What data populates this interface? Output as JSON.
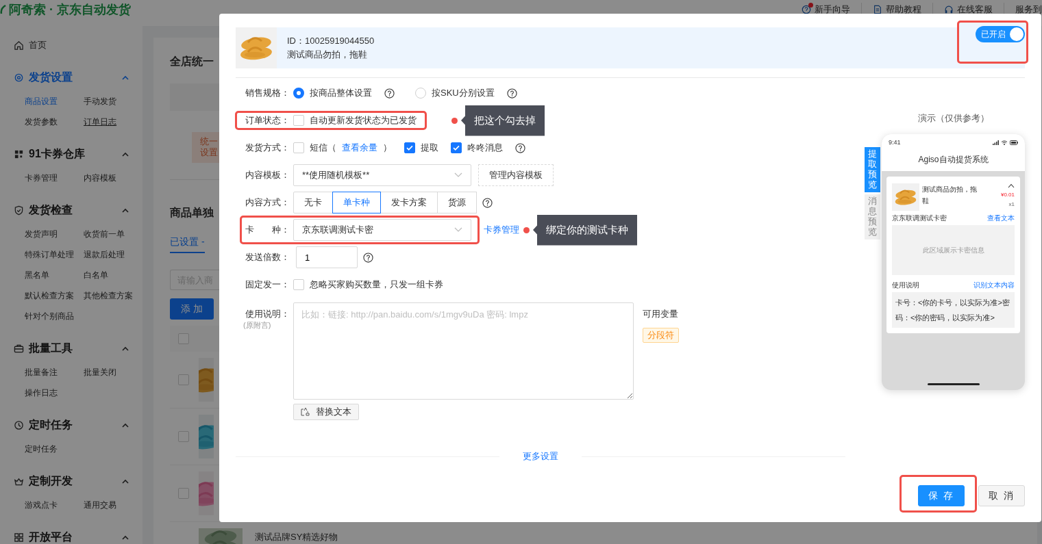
{
  "header": {
    "logo": "阿奇索 · 京东自动发货",
    "links": [
      {
        "label": "新手向导",
        "notification": true
      },
      {
        "label": "帮助教程",
        "notification": false
      },
      {
        "label": "在线客服",
        "notification": false
      },
      {
        "label": "服务到",
        "notification": false
      }
    ]
  },
  "sidebar": {
    "home": "首页",
    "groups": [
      {
        "title": "发货设置",
        "selected": true,
        "expanded": true,
        "items": [
          {
            "label": "商品设置",
            "selected": true,
            "hovered": false
          },
          {
            "label": "手动发货",
            "selected": false,
            "hovered": false
          },
          {
            "label": "发货参数",
            "selected": false,
            "hovered": false
          },
          {
            "label": "订单日志",
            "selected": false,
            "hovered": true
          }
        ]
      },
      {
        "title": "91卡券仓库",
        "selected": false,
        "expanded": true,
        "items": [
          {
            "label": "卡券管理",
            "selected": false,
            "hovered": false
          },
          {
            "label": "内容模板",
            "selected": false,
            "hovered": false
          }
        ]
      },
      {
        "title": "发货检查",
        "selected": false,
        "expanded": true,
        "items": [
          {
            "label": "发货声明",
            "selected": false,
            "hovered": false
          },
          {
            "label": "收货前一单",
            "selected": false,
            "hovered": false
          },
          {
            "label": "特殊订单处理",
            "selected": false,
            "hovered": false
          },
          {
            "label": "退款后处理",
            "selected": false,
            "hovered": false
          },
          {
            "label": "黑名单",
            "selected": false,
            "hovered": false
          },
          {
            "label": "白名单",
            "selected": false,
            "hovered": false
          },
          {
            "label": "默认检查方案",
            "selected": false,
            "hovered": false
          },
          {
            "label": "其他检查方案",
            "selected": false,
            "hovered": false
          },
          {
            "label": "针对个别商品",
            "selected": false,
            "hovered": false
          }
        ]
      },
      {
        "title": "批量工具",
        "selected": false,
        "expanded": true,
        "items": [
          {
            "label": "批量备注",
            "selected": false,
            "hovered": false
          },
          {
            "label": "批量关闭",
            "selected": false,
            "hovered": false
          },
          {
            "label": "操作日志",
            "selected": false,
            "hovered": false
          }
        ]
      },
      {
        "title": "定时任务",
        "selected": false,
        "expanded": true,
        "items": [
          {
            "label": "定时任务",
            "selected": false,
            "hovered": false
          }
        ]
      },
      {
        "title": "定制开发",
        "selected": false,
        "expanded": true,
        "items": [
          {
            "label": "游戏点卡",
            "selected": false,
            "hovered": false
          },
          {
            "label": "通用交易",
            "selected": false,
            "hovered": false
          }
        ]
      },
      {
        "title": "开放平台",
        "selected": false,
        "expanded": true
      }
    ]
  },
  "content": {
    "title": "全店统一",
    "notice": "统一设置",
    "section_title": "商品单独",
    "tab": {
      "label": "已设置 -",
      "selected": true
    },
    "search_placeholder": "请输入商",
    "add_button": "添 加",
    "header_checked": false,
    "rows": [
      {
        "kind": "picture",
        "checked": false
      },
      {
        "kind": "picture",
        "checked": false
      },
      {
        "kind": "picture",
        "checked": false
      },
      {
        "kind": "picture",
        "name": "测试品牌SY精选好物"
      }
    ]
  },
  "modal": {
    "product": {
      "id_text": "ID：10025919044550",
      "name": "测试商品勿拍，拖鞋"
    },
    "toggle": {
      "label": "已开启",
      "on": true,
      "highlighted": true
    },
    "form": [
      {
        "kind": "radio",
        "label": "销售规格：",
        "options": [
          {
            "label": "按商品整体设置",
            "selected": true
          },
          {
            "label": "按SKU分别设置",
            "selected": false
          }
        ]
      },
      {
        "kind": "checkbox",
        "label": "订单状态：",
        "highlighted": true,
        "callout": "把这个勾去掉",
        "options": [
          {
            "label": "自动更新发货状态为已发货",
            "checked": false
          }
        ]
      },
      {
        "kind": "checkbox",
        "label": "发货方式：",
        "help": true,
        "options": [
          {
            "label": "短信（",
            "link": "查看余量",
            "suffix": "）",
            "checked": false
          },
          {
            "label": "提取",
            "checked": true
          },
          {
            "label": "咚咚消息",
            "checked": true
          }
        ]
      },
      {
        "kind": "select",
        "label": "内容模板：",
        "value": "**使用随机模板**",
        "button": "管理内容模板"
      },
      {
        "kind": "segmented",
        "label": "内容方式：",
        "help": true,
        "options": [
          {
            "label": "无卡",
            "selected": false
          },
          {
            "label": "单卡种",
            "selected": true
          },
          {
            "label": "发卡方案",
            "selected": false
          },
          {
            "label": "货源",
            "selected": false
          }
        ]
      },
      {
        "kind": "select",
        "label": "卡　　种：",
        "highlighted": true,
        "value": "京东联调测试卡密",
        "link": "卡券管理",
        "callout": "绑定你的测试卡种"
      },
      {
        "kind": "number",
        "label": "发送倍数：",
        "value": "1",
        "help": true
      },
      {
        "kind": "checkbox",
        "label": "固定发一：",
        "options": [
          {
            "label": "忽略买家购买数量，只发一组卡券",
            "checked": false
          }
        ]
      },
      {
        "kind": "textarea",
        "label": "使用说明：",
        "sublabel": "(原附言)",
        "placeholder": "比如：链接: http://pan.baidu.com/s/1mgv9uDa 密码: lmpz",
        "button": "替换文本",
        "variables_title": "可用变量",
        "variables": [
          "分段符"
        ]
      }
    ],
    "more_link": "更多设置",
    "preview": {
      "title": "演示（仅供参考）",
      "tabs": [
        {
          "label": "提取预览",
          "selected": true
        },
        {
          "label": "消息预览",
          "selected": false
        }
      ],
      "phone": {
        "time": "9:41",
        "app_title": "Agiso自动提货系统",
        "product_name": "测试商品勿拍，拖鞋",
        "price": "¥0.01",
        "quantity": "x1",
        "card_name": "京东联调测试卡密",
        "card_link": "查看文本",
        "card_placeholder": "此区域展示卡密信息",
        "usage_title": "使用说明",
        "usage_link": "识别文本内容",
        "usage_text": "卡号：<你的卡号，以实际为准>密码：<你的密码，以实际为准>"
      }
    },
    "buttons": [
      {
        "label": "保 存",
        "kind": "primary",
        "highlighted": true
      },
      {
        "label": "取 消",
        "kind": "default"
      }
    ]
  }
}
